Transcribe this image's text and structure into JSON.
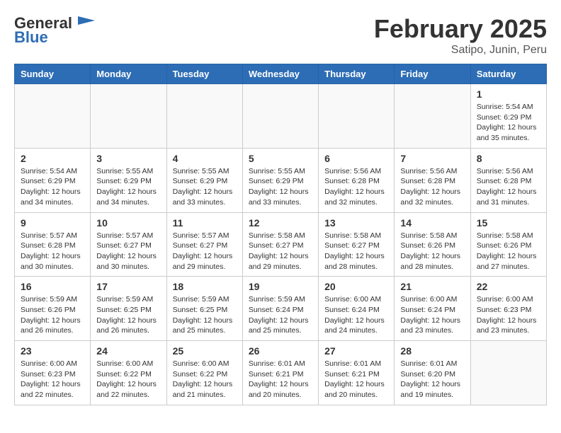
{
  "header": {
    "logo_general": "General",
    "logo_blue": "Blue",
    "month_title": "February 2025",
    "location": "Satipo, Junin, Peru"
  },
  "calendar": {
    "days_of_week": [
      "Sunday",
      "Monday",
      "Tuesday",
      "Wednesday",
      "Thursday",
      "Friday",
      "Saturday"
    ],
    "weeks": [
      [
        {
          "day": "",
          "info": ""
        },
        {
          "day": "",
          "info": ""
        },
        {
          "day": "",
          "info": ""
        },
        {
          "day": "",
          "info": ""
        },
        {
          "day": "",
          "info": ""
        },
        {
          "day": "",
          "info": ""
        },
        {
          "day": "1",
          "info": "Sunrise: 5:54 AM\nSunset: 6:29 PM\nDaylight: 12 hours\nand 35 minutes."
        }
      ],
      [
        {
          "day": "2",
          "info": "Sunrise: 5:54 AM\nSunset: 6:29 PM\nDaylight: 12 hours\nand 34 minutes."
        },
        {
          "day": "3",
          "info": "Sunrise: 5:55 AM\nSunset: 6:29 PM\nDaylight: 12 hours\nand 34 minutes."
        },
        {
          "day": "4",
          "info": "Sunrise: 5:55 AM\nSunset: 6:29 PM\nDaylight: 12 hours\nand 33 minutes."
        },
        {
          "day": "5",
          "info": "Sunrise: 5:55 AM\nSunset: 6:29 PM\nDaylight: 12 hours\nand 33 minutes."
        },
        {
          "day": "6",
          "info": "Sunrise: 5:56 AM\nSunset: 6:28 PM\nDaylight: 12 hours\nand 32 minutes."
        },
        {
          "day": "7",
          "info": "Sunrise: 5:56 AM\nSunset: 6:28 PM\nDaylight: 12 hours\nand 32 minutes."
        },
        {
          "day": "8",
          "info": "Sunrise: 5:56 AM\nSunset: 6:28 PM\nDaylight: 12 hours\nand 31 minutes."
        }
      ],
      [
        {
          "day": "9",
          "info": "Sunrise: 5:57 AM\nSunset: 6:28 PM\nDaylight: 12 hours\nand 30 minutes."
        },
        {
          "day": "10",
          "info": "Sunrise: 5:57 AM\nSunset: 6:27 PM\nDaylight: 12 hours\nand 30 minutes."
        },
        {
          "day": "11",
          "info": "Sunrise: 5:57 AM\nSunset: 6:27 PM\nDaylight: 12 hours\nand 29 minutes."
        },
        {
          "day": "12",
          "info": "Sunrise: 5:58 AM\nSunset: 6:27 PM\nDaylight: 12 hours\nand 29 minutes."
        },
        {
          "day": "13",
          "info": "Sunrise: 5:58 AM\nSunset: 6:27 PM\nDaylight: 12 hours\nand 28 minutes."
        },
        {
          "day": "14",
          "info": "Sunrise: 5:58 AM\nSunset: 6:26 PM\nDaylight: 12 hours\nand 28 minutes."
        },
        {
          "day": "15",
          "info": "Sunrise: 5:58 AM\nSunset: 6:26 PM\nDaylight: 12 hours\nand 27 minutes."
        }
      ],
      [
        {
          "day": "16",
          "info": "Sunrise: 5:59 AM\nSunset: 6:26 PM\nDaylight: 12 hours\nand 26 minutes."
        },
        {
          "day": "17",
          "info": "Sunrise: 5:59 AM\nSunset: 6:25 PM\nDaylight: 12 hours\nand 26 minutes."
        },
        {
          "day": "18",
          "info": "Sunrise: 5:59 AM\nSunset: 6:25 PM\nDaylight: 12 hours\nand 25 minutes."
        },
        {
          "day": "19",
          "info": "Sunrise: 5:59 AM\nSunset: 6:24 PM\nDaylight: 12 hours\nand 25 minutes."
        },
        {
          "day": "20",
          "info": "Sunrise: 6:00 AM\nSunset: 6:24 PM\nDaylight: 12 hours\nand 24 minutes."
        },
        {
          "day": "21",
          "info": "Sunrise: 6:00 AM\nSunset: 6:24 PM\nDaylight: 12 hours\nand 23 minutes."
        },
        {
          "day": "22",
          "info": "Sunrise: 6:00 AM\nSunset: 6:23 PM\nDaylight: 12 hours\nand 23 minutes."
        }
      ],
      [
        {
          "day": "23",
          "info": "Sunrise: 6:00 AM\nSunset: 6:23 PM\nDaylight: 12 hours\nand 22 minutes."
        },
        {
          "day": "24",
          "info": "Sunrise: 6:00 AM\nSunset: 6:22 PM\nDaylight: 12 hours\nand 22 minutes."
        },
        {
          "day": "25",
          "info": "Sunrise: 6:00 AM\nSunset: 6:22 PM\nDaylight: 12 hours\nand 21 minutes."
        },
        {
          "day": "26",
          "info": "Sunrise: 6:01 AM\nSunset: 6:21 PM\nDaylight: 12 hours\nand 20 minutes."
        },
        {
          "day": "27",
          "info": "Sunrise: 6:01 AM\nSunset: 6:21 PM\nDaylight: 12 hours\nand 20 minutes."
        },
        {
          "day": "28",
          "info": "Sunrise: 6:01 AM\nSunset: 6:20 PM\nDaylight: 12 hours\nand 19 minutes."
        },
        {
          "day": "",
          "info": ""
        }
      ]
    ]
  }
}
